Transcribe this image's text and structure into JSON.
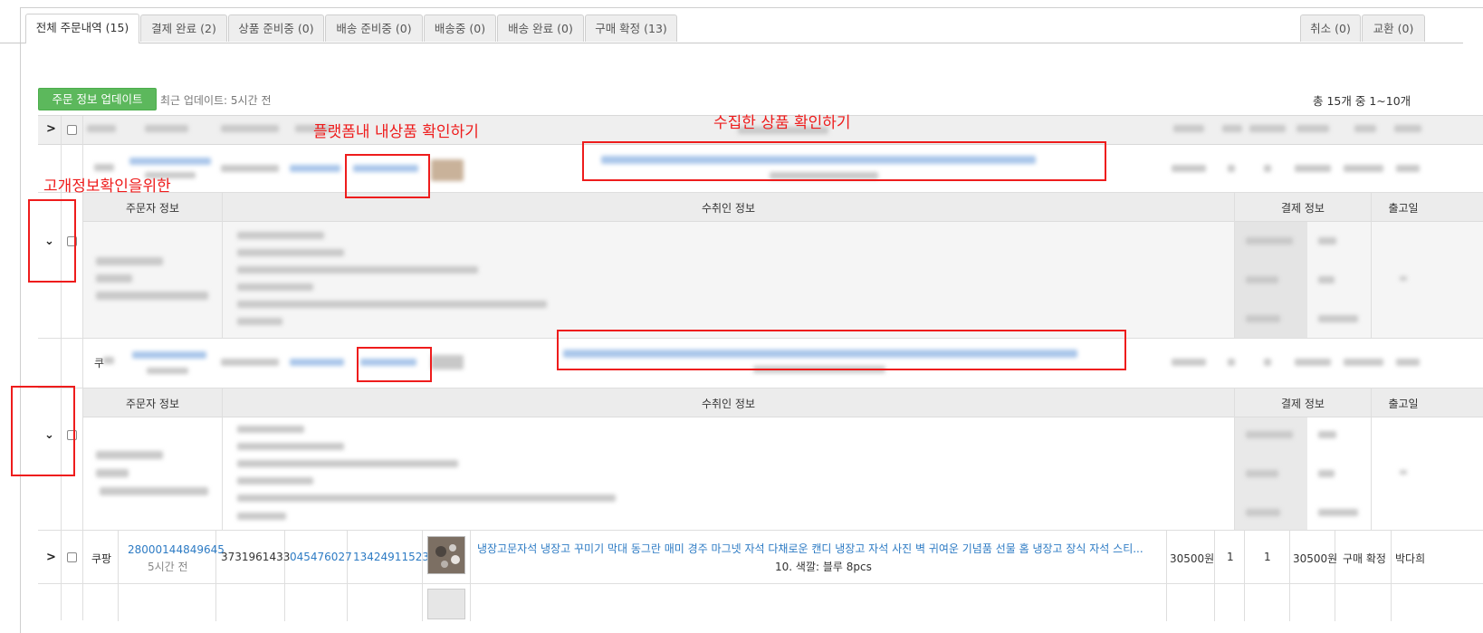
{
  "tabs": [
    {
      "label": "전체 주문내역 (15)",
      "active": true
    },
    {
      "label": "결제 완료 (2)"
    },
    {
      "label": "상품 준비중 (0)"
    },
    {
      "label": "배송 준비중 (0)"
    },
    {
      "label": "배송중 (0)"
    },
    {
      "label": "배송 완료 (0)"
    },
    {
      "label": "구매 확정 (13)"
    }
  ],
  "tabs_right": [
    {
      "label": "취소 (0)"
    },
    {
      "label": "교환 (0)"
    }
  ],
  "toolbar": {
    "update_button": "주문 정보 업데이트",
    "last_update": "최근 업데이트: 5시간 전",
    "pagination_summary": "총 15개 중 1~10개"
  },
  "annotations": {
    "platform_product": "플랫폼내 내상품 확인하기",
    "collected_product": "수집한 상품 확인하기",
    "customer_info": "고개정보확인을위한"
  },
  "detail_headers": {
    "orderer": "주문자 정보",
    "recipient": "수취인 정보",
    "payment": "결제 정보",
    "shipping_date": "출고일"
  },
  "row_partial": {
    "market_prefix": "쿠"
  },
  "orders": [
    {
      "market": "쿠팡",
      "order_no": "28000144849645",
      "time_ago": "5시간 전",
      "id1": "3731961433",
      "id2": "045476027",
      "id3": "13424911523",
      "product_name": "냉장고문자석 냉장고 꾸미기 막대 동그란 매미 경주 마그넷 자석 다채로운 캔디 냉장고 자석 사진 벽 귀여운 기념품 선물 홈 냉장고 장식 자석 스티...",
      "option": "10. 색깔: 블루 8pcs",
      "price": "30500원",
      "qty1": "1",
      "qty2": "1",
      "total": "30500원",
      "status": "구매 확정",
      "delivery": "박다희"
    }
  ],
  "colors": {
    "accent_green": "#5cb85c",
    "link_blue": "#2d7bc4",
    "annotation_red": "#ee1c1c"
  },
  "icons": {
    "expand": "chevron-right-icon",
    "collapse": "chevron-down-icon"
  }
}
